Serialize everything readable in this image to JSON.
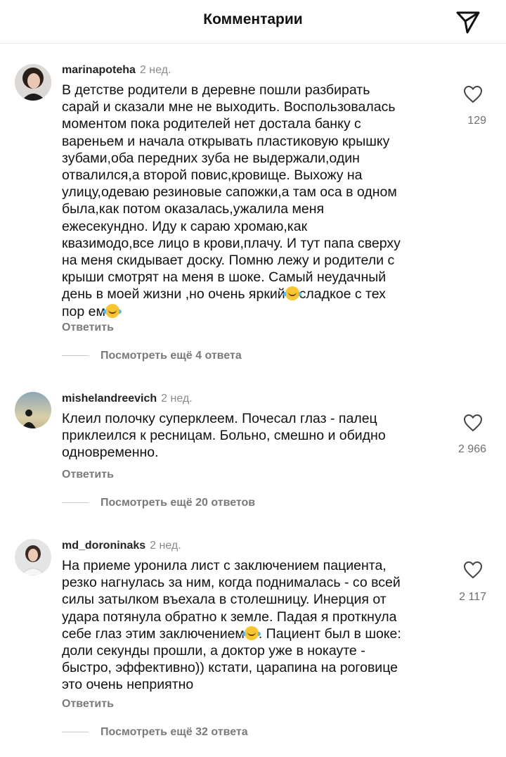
{
  "header": {
    "title": "Комментарии",
    "share_icon": "send-icon"
  },
  "comments": [
    {
      "username": "marinapoteha",
      "time": "2 нед.",
      "lines": [
        {
          "text": "В детстве родители в деревне пошли разбирать"
        },
        {
          "text": "сарай и сказали мне не выходить. Воспользовалась"
        },
        {
          "text": "моментом пока родителей нет достала банку с"
        },
        {
          "text": "вареньем и начала открывать пластиковую крышку"
        },
        {
          "text": "зубами,оба передних зуба не выдержали,один"
        },
        {
          "text": "отвалился,а второй повис,кровище. Выхожу на"
        },
        {
          "text": "улицу,одеваю резиновые сапожки,а там оса в одном"
        },
        {
          "text": "была,как потом оказалась,ужалила меня"
        },
        {
          "text": "ежесекундно. Иду к сараю хромаю,как"
        },
        {
          "text": "квазимодо,все лицо в крови,плачу. И тут папа сверху"
        },
        {
          "text": "на меня скидывает доску. Помню лежу и родители с"
        },
        {
          "text": "крыши смотрят на меня в шоке. Самый неудачный"
        },
        {
          "text": "день в моей жизни ,но очень яркий",
          "emoji": "tears-of-joy-emoji",
          "after": "сладкое с тех"
        },
        {
          "text": "пор ем",
          "emoji": "tears-of-joy-emoji",
          "after": ""
        }
      ],
      "likes": "129",
      "reply_label": "Ответить",
      "more_replies": "Посмотреть ещё 4 ответа",
      "avatar": "woman-dark-hair-avatar"
    },
    {
      "username": "mishelandreevich",
      "time": "2 нед.",
      "lines": [
        {
          "text": "Клеил полочку суперклеем. Почесал глаз - палец"
        },
        {
          "text": "приклеился к ресницам. Больно, смешно и обидно"
        },
        {
          "text": "одновременно."
        }
      ],
      "likes": "2 966",
      "reply_label": "Ответить",
      "more_replies": "Посмотреть ещё 20 ответов",
      "avatar": "silhouette-sunset-avatar"
    },
    {
      "username": "md_doroninaks",
      "time": "2 нед.",
      "lines": [
        {
          "text": "На приеме уронила лист с заключением пациента,"
        },
        {
          "text": "резко нагнулась за ним, когда поднималась - со всей"
        },
        {
          "text": "силы затылком въехала в столешницу. Инерция от"
        },
        {
          "text": "удара потянула обратно к земле. Падая я проткнула"
        },
        {
          "text": "себе глаз этим заключением",
          "emoji": "tears-of-joy-emoji",
          "after": ". Пациент был в шоке:"
        },
        {
          "text": "доли секунды прошли, а доктор уже в нокауте -"
        },
        {
          "text": "быстро, эффективно)) кстати, царапина на роговице"
        },
        {
          "text": "это очень неприятно"
        }
      ],
      "likes": "2 117",
      "reply_label": "Ответить",
      "more_replies": "Посмотреть ещё 32 ответа",
      "avatar": "woman-doctor-avatar"
    }
  ],
  "colors": {
    "text": "#111111",
    "muted": "#7a7a7a",
    "divider": "#e6e6e6"
  }
}
